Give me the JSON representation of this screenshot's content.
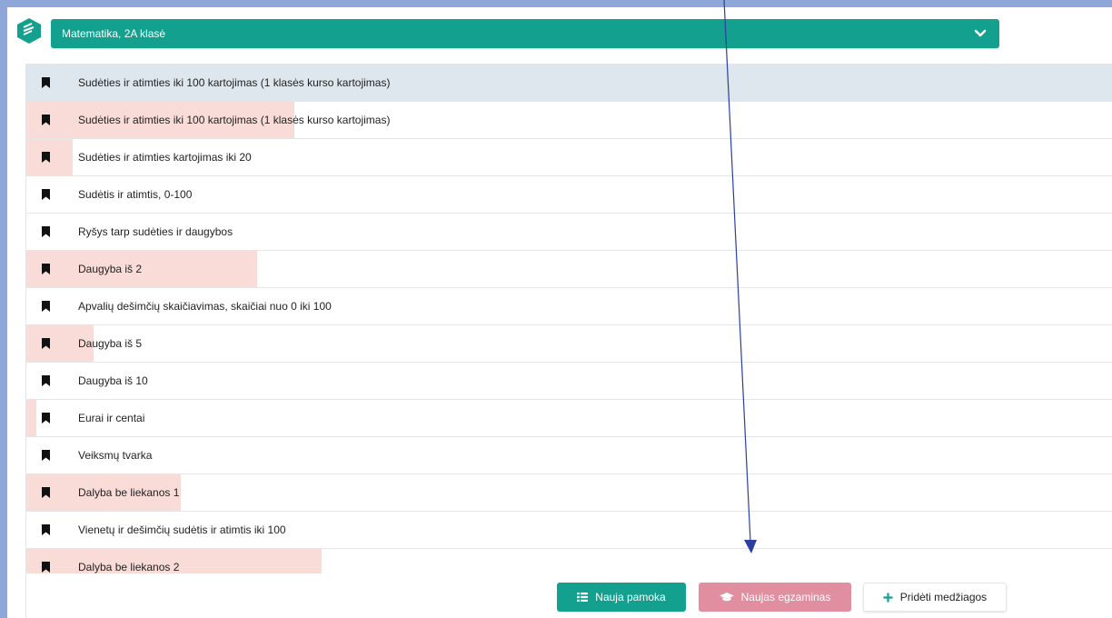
{
  "header": {
    "course_label": "Matematika, 2A klasė",
    "logo_icon": "cube-logo-icon",
    "dropdown_icon": "chevron-down-icon",
    "accent_color": "#14a08e"
  },
  "lessons": [
    {
      "title": "Sudėties ir atimties iki 100 kartojimas (1 klasės kurso kartojimas)",
      "progress": 0,
      "active": true
    },
    {
      "title": "Sudėties ir atimties iki 100 kartojimas (1 klasės kurso kartojimas)",
      "progress": 0.247
    },
    {
      "title": "Sudėties ir atimties kartojimas iki 20",
      "progress": 0.043
    },
    {
      "title": "Sudėtis ir atimtis, 0-100",
      "progress": 0
    },
    {
      "title": "Ryšys tarp sudėties ir daugybos",
      "progress": 0
    },
    {
      "title": "Daugyba iš 2",
      "progress": 0.212
    },
    {
      "title": "Apvalių dešimčių skaičiavimas, skaičiai nuo 0 iki 100",
      "progress": 0
    },
    {
      "title": "Daugyba iš 5",
      "progress": 0.062
    },
    {
      "title": "Daugyba iš 10",
      "progress": 0
    },
    {
      "title": "Eurai ir centai",
      "progress": 0.009
    },
    {
      "title": "Veiksmų tvarka",
      "progress": 0
    },
    {
      "title": "Dalyba be liekanos 1",
      "progress": 0.142
    },
    {
      "title": "Vienetų ir dešimčių sudėtis ir atimtis iki 100",
      "progress": 0
    },
    {
      "title": "Dalyba be liekanos 2",
      "progress": 0.272
    }
  ],
  "actions": {
    "new_lesson": "Nauja pamoka",
    "new_exam": "Naujas egzaminas",
    "add_material": "Pridėti medžiagos"
  },
  "colors": {
    "progress_fill": "#f9dcd8",
    "active_row": "#dee7ed",
    "exam_button": "#e08ea0",
    "annotation_arrow": "#2a3fa0"
  }
}
